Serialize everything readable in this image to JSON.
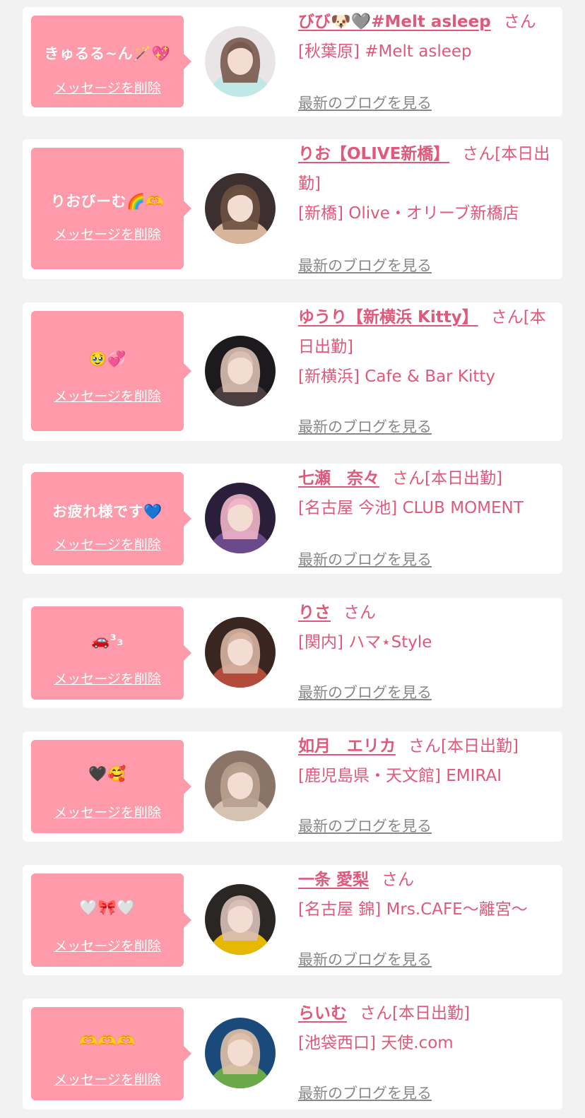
{
  "colors": {
    "bubble": "#ff9aaa",
    "accent": "#e0587a",
    "link_gray": "#888888",
    "background": "#f2f2f2",
    "card": "#ffffff"
  },
  "delete_label": "メッセージを削除",
  "blog_label": "最新のブログを見る",
  "suffix": "さん",
  "items": [
    {
      "message": "きゅるる~ん🪄💖",
      "name": "びび🐶🩶#Melt asleep",
      "status": "",
      "shop": "[秋葉原] #Melt asleep",
      "avatar_icon": "girl-portrait-icon"
    },
    {
      "message": "りおびーむ🌈🫶",
      "name": "りお【OLIVE新橋】",
      "status": "[本日出勤]",
      "shop": "[新橋] Olive・オリーブ新橋店",
      "avatar_icon": "girl-portrait-icon"
    },
    {
      "message": "🥹💞",
      "name": "ゆうり【新横浜 Kitty】",
      "status": "[本日出勤]",
      "shop": "[新横浜] Cafe & Bar Kitty",
      "avatar_icon": "girl-portrait-icon"
    },
    {
      "message": "お疲れ様です💙",
      "name": "七瀬　奈々",
      "status": "[本日出勤]",
      "shop": "[名古屋 今池] CLUB MOMENT",
      "avatar_icon": "girl-portrait-icon"
    },
    {
      "message": "🚗³₃",
      "name": "りさ",
      "status": "",
      "shop": "[関内] ハマ⋆Style",
      "avatar_icon": "girl-portrait-icon"
    },
    {
      "message": "🖤🥰",
      "name": "如月　エリカ",
      "status": "[本日出勤]",
      "shop": "[鹿児島県・天文館] EMIRAI",
      "avatar_icon": "girl-portrait-icon"
    },
    {
      "message": "🤍🎀🤍",
      "name": "一条 愛梨",
      "status": "",
      "shop": "[名古屋 錦] Mrs.CAFE〜離宮〜",
      "avatar_icon": "girl-portrait-icon"
    },
    {
      "message": "🫶🫶🫶",
      "name": "らいむ",
      "status": "[本日出勤]",
      "shop": "[池袋西口] 天使.com",
      "avatar_icon": "girl-portrait-icon"
    }
  ]
}
